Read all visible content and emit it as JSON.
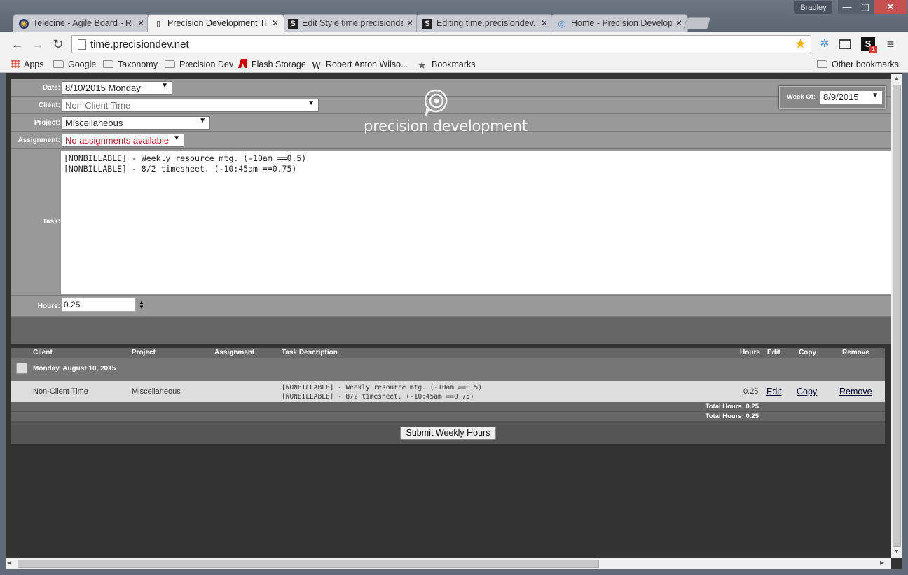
{
  "window": {
    "user": "Bradley",
    "min": "—",
    "max": "▢",
    "close": "✕"
  },
  "tabs": [
    {
      "title": "Telecine - Agile Board - R",
      "icon": "◉"
    },
    {
      "title": "Precision Development Ti",
      "icon": "▯"
    },
    {
      "title": "Edit Style time.precisionde",
      "icon": "S"
    },
    {
      "title": "Editing time.precisiondev.",
      "icon": "S"
    },
    {
      "title": "Home - Precision Develop",
      "icon": "◎"
    }
  ],
  "tab_close": "✕",
  "toolbar": {
    "back": "←",
    "forward": "→",
    "reload": "↻",
    "url": "time.precisiondev.net",
    "star": "★",
    "menu": "≡",
    "ext_s": "S",
    "ext_badge": "1",
    "ext_globe": "✲"
  },
  "bookmarks": [
    {
      "label": "Apps",
      "icon": "apps"
    },
    {
      "label": "Google",
      "icon": "folder"
    },
    {
      "label": "Taxonomy",
      "icon": "folder"
    },
    {
      "label": "Precision Dev",
      "icon": "folder"
    },
    {
      "label": "Flash Storage",
      "icon": "adobe"
    },
    {
      "label": "Robert Anton Wilso...",
      "icon": "wiki"
    },
    {
      "label": "Bookmarks",
      "icon": "star"
    }
  ],
  "other_bookmarks": "Other bookmarks",
  "wiki_glyph": "W",
  "star_glyph": "★",
  "form": {
    "date_label": "Date:",
    "date_value": "8/10/2015 Monday",
    "client_label": "Client:",
    "client_value": "Non-Client Time",
    "project_label": "Project:",
    "project_value": "Miscellaneous",
    "assignment_label": "Assignment:",
    "assignment_value": "No assignments available",
    "task_label": "Task:",
    "task_text": "[NONBILLABLE] - Weekly resource mtg. (-10am ==0.5)\n[NONBILLABLE] - 8/2 timesheet. (-10:45am ==0.75)",
    "hours_label": "Hours:",
    "hours_value": "0.25",
    "caret": "▼",
    "spin": "▲\n▼"
  },
  "logo": {
    "text_a": "precision",
    "text_b": " development"
  },
  "week_of": {
    "label": "Week Of:",
    "value": "8/9/2015"
  },
  "table": {
    "headers": {
      "client": "Client",
      "project": "Project",
      "assignment": "Assignment",
      "task": "Task Description",
      "hours": "Hours",
      "edit": "Edit",
      "copy": "Copy",
      "remove": "Remove"
    },
    "day_title": "Monday, August 10, 2015",
    "entry": {
      "client": "Non-Client Time",
      "project": "Miscellaneous",
      "assignment": "",
      "task": "[NONBILLABLE] - Weekly resource mtg. (-10am ==0.5)\n[NONBILLABLE] - 8/2 timesheet. (-10:45am ==0.75)",
      "hours": "0.25",
      "edit": "Edit",
      "copy": "Copy",
      "remove": "Remove"
    },
    "day_total": "Total Hours: 0.25",
    "week_total": "Total Hours: 0.25",
    "submit": "Submit Weekly Hours"
  },
  "scroll": {
    "up": "▲",
    "down": "▼",
    "left": "◀",
    "right": "▶"
  }
}
